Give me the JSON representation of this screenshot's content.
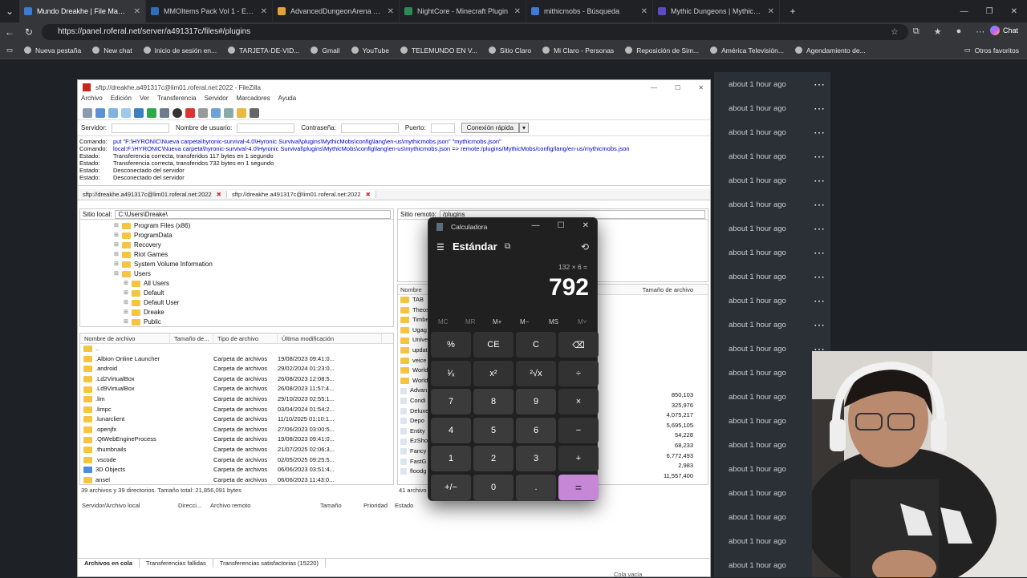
{
  "browser": {
    "tabs": [
      {
        "label": "Mundo Dreakhe | File Manager",
        "active": true,
        "color": "#3b7bd8"
      },
      {
        "label": "MMOItems Pack Vol 1 - Extra info",
        "active": false,
        "color": "#2f6fb8"
      },
      {
        "label": "AdvancedDungeonArena ⭐ Scrip",
        "active": false,
        "color": "#e6a23a"
      },
      {
        "label": "NightCore - Minecraft Plugin",
        "active": false,
        "color": "#2c8a57"
      },
      {
        "label": "mithicmobs - Búsqueda",
        "active": false,
        "color": "#3f79d9"
      },
      {
        "label": "Mythic Dungeons | MythicCraft M",
        "active": false,
        "color": "#5a4cc7"
      }
    ],
    "url": "https://panel.roferal.net/server/a491317c/files#/plugins",
    "chat_label": "Chat",
    "bookmarks": [
      "Nueva pestaña",
      "New chat",
      "Inicio de sesión en...",
      "TARJETA-DE-VID...",
      "Gmail",
      "YouTube",
      "TELEMUNDO EN V...",
      "Sitio Claro",
      "Mi Claro - Personas",
      "Reposición de Sim...",
      "América Televisión...",
      "Agendamiento de..."
    ],
    "other_bookmarks": "Otros favoritos"
  },
  "panel": {
    "time_label": "about 1 hour ago",
    "rows": 21
  },
  "filezilla": {
    "title": "sftp://dreakhe.a491317c@lim01.roferal.net:2022 - FileZilla",
    "menu": [
      "Archivo",
      "Edición",
      "Ver",
      "Transferencia",
      "Servidor",
      "Marcadores",
      "Ayuda"
    ],
    "quick": {
      "server": "Servidor:",
      "user": "Nombre de usuario:",
      "pass": "Contraseña:",
      "port": "Puerto:",
      "connect": "Conexión rápida"
    },
    "log": [
      {
        "k": "Comando:",
        "v": "put \"F:\\HYRONIC\\Nueva carpeta\\hyronic-survival-4.0\\Hyronic Survival\\plugins\\MythicMobs\\config\\lang\\en-us\\mythicmobs.json\" \"mythicmobs.json\"",
        "cmd": true
      },
      {
        "k": "Comando:",
        "v": "local:F:\\HYRONIC\\Nueva carpeta\\hyronic-survival-4.0\\Hyronic Survival\\plugins\\MythicMobs\\config\\lang\\en-us\\mythicmobs.json => remote:/plugins/MythicMobs/config/lang/en-us/mythicmobs.json",
        "cmd": true
      },
      {
        "k": "Estado:",
        "v": "Transferencia correcta, transferidos 117 bytes en 1 segundo",
        "cmd": false
      },
      {
        "k": "Estado:",
        "v": "Transferencia correcta, transferidos 732 bytes en 1 segundo",
        "cmd": false
      },
      {
        "k": "Estado:",
        "v": "Desconectado del servidor",
        "cmd": false
      },
      {
        "k": "Estado:",
        "v": "Desconectado del servidor",
        "cmd": false
      }
    ],
    "tabs": [
      "sftp://dreakhe.a491317c@lim01.roferal.net:2022",
      "sftp://dreakhe.a491317c@lim01.roferal.net:2022"
    ],
    "local_label": "Sitio local:",
    "local_path": "C:\\Users\\Dreake\\",
    "remote_label": "Sitio remoto:",
    "remote_path": "/plugins",
    "tree": [
      "Program Files (x86)",
      "ProgramData",
      "Recovery",
      "Riot Games",
      "System Volume Information",
      "Users",
      "All Users",
      "Default",
      "Default User",
      "Dreake",
      "Public"
    ],
    "local_headers": [
      "Nombre de archivo",
      "Tamaño de...",
      "Tipo de archivo",
      "Última modificación"
    ],
    "local_files": [
      {
        "n": "..",
        "t": "",
        "d": ""
      },
      {
        "n": ".Albion Online Launcher",
        "t": "Carpeta de archivos",
        "d": "19/08/2023 09:41:0..."
      },
      {
        "n": ".android",
        "t": "Carpeta de archivos",
        "d": "29/02/2024 01:23:0..."
      },
      {
        "n": ".Ld2VirtualBox",
        "t": "Carpeta de archivos",
        "d": "26/08/2023 12:08:5..."
      },
      {
        "n": ".Ld9VirtualBox",
        "t": "Carpeta de archivos",
        "d": "26/08/2023 11:57:4..."
      },
      {
        "n": ".lim",
        "t": "Carpeta de archivos",
        "d": "29/10/2023 02:55:1..."
      },
      {
        "n": ".limpc",
        "t": "Carpeta de archivos",
        "d": "03/04/2024 01:54:2..."
      },
      {
        "n": ".lunarclient",
        "t": "Carpeta de archivos",
        "d": "11/10/2025 01:10:1..."
      },
      {
        "n": ".openjfx",
        "t": "Carpeta de archivos",
        "d": "27/06/2023 03:00:5..."
      },
      {
        "n": ".QtWebEngineProcess",
        "t": "Carpeta de archivos",
        "d": "19/08/2023 09:41:0..."
      },
      {
        "n": ".thumbnails",
        "t": "Carpeta de archivos",
        "d": "21/07/2025 02:06:3..."
      },
      {
        "n": ".vscode",
        "t": "Carpeta de archivos",
        "d": "02/05/2025 09:25:5..."
      },
      {
        "n": "3D Objects",
        "t": "Carpeta de archivos",
        "d": "06/06/2023 03:51:4..."
      },
      {
        "n": "ansel",
        "t": "Carpeta de archivos",
        "d": "06/06/2023 11:43:0..."
      }
    ],
    "local_status": "39 archivos y 39 directorios. Tamaño total: 21,856,091 bytes",
    "remote_headers": [
      "Nombre",
      "Tamaño de archivo"
    ],
    "remote_files": [
      "TAB",
      "Theos",
      "Timbe",
      "Ugag",
      "Unive",
      "updat",
      "veice",
      "World",
      "World",
      "Advan",
      "Condi",
      "Deluxe",
      "Depo",
      "Entity",
      "EzSho",
      "Fancy",
      "FastG",
      "floodg"
    ],
    "remote_sizes": [
      "850,103",
      "325,976",
      "4,075,217",
      "5,695,105",
      "54,228",
      "68,233",
      "6,772,493",
      "2,983",
      "11,557,400"
    ],
    "remote_status": "41 archivo",
    "queue_headers": [
      "Servidor/Archivo local",
      "Direcci...",
      "Archivo remoto",
      "Tamaño",
      "Prioridad",
      "Estado"
    ],
    "queue_tabs": [
      "Archivos en cola",
      "Transferencias fallidas",
      "Transferencias satisfactorias (15220)"
    ],
    "queue_status": "Cola vacía"
  },
  "calculator": {
    "title": "Calculadora",
    "mode": "Estándar",
    "expression": "132 × 6 =",
    "display": "792",
    "memory": [
      "MC",
      "MR",
      "M+",
      "M−",
      "MS",
      "M˅"
    ],
    "keys": [
      "%",
      "CE",
      "C",
      "⌫",
      "¹⁄ₓ",
      "x²",
      "²√x",
      "÷",
      "7",
      "8",
      "9",
      "×",
      "4",
      "5",
      "6",
      "−",
      "1",
      "2",
      "3",
      "+",
      "+/−",
      "0",
      ".",
      "="
    ]
  }
}
